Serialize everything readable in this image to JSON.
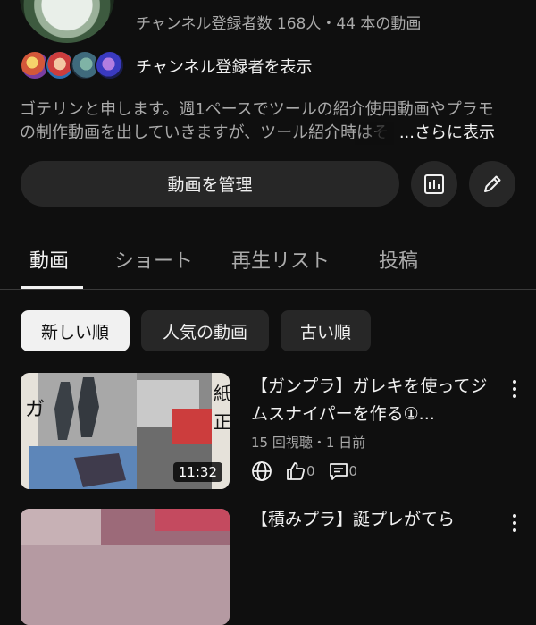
{
  "channel": {
    "meta": "チャンネル登録者数 168人・44 本の動画",
    "subscribers_link": "チャンネル登録者を表示",
    "description_line1": "ゴテリンと申します。週1ペースでツールの紹介使用動画やプラモ",
    "description_line2": "の制作動画を出していきますが、ツール紹介時はそ",
    "description_more": "...さらに表示"
  },
  "actions": {
    "manage_label": "動画を管理",
    "analytics_icon": "bar-chart-icon",
    "edit_icon": "pencil-icon"
  },
  "tabs": [
    {
      "label": "動画",
      "active": true
    },
    {
      "label": "ショート"
    },
    {
      "label": "再生リスト"
    },
    {
      "label": "投稿"
    }
  ],
  "filters": [
    {
      "label": "新しい順",
      "selected": true
    },
    {
      "label": "人気の動画"
    },
    {
      "label": "古い順"
    }
  ],
  "videos": [
    {
      "title": "【ガンプラ】ガレキを使ってジムスナイパーを作る①...",
      "stats": "15 回視聴・1 日前",
      "duration": "11:32",
      "likes": "0",
      "comments": "0"
    },
    {
      "title": "【積みプラ】誕プレがてら"
    }
  ],
  "colors": {
    "background": "#0f0f0f",
    "surface": "#272727",
    "text_primary": "#f1f1f1",
    "text_secondary": "#aaaaaa"
  }
}
